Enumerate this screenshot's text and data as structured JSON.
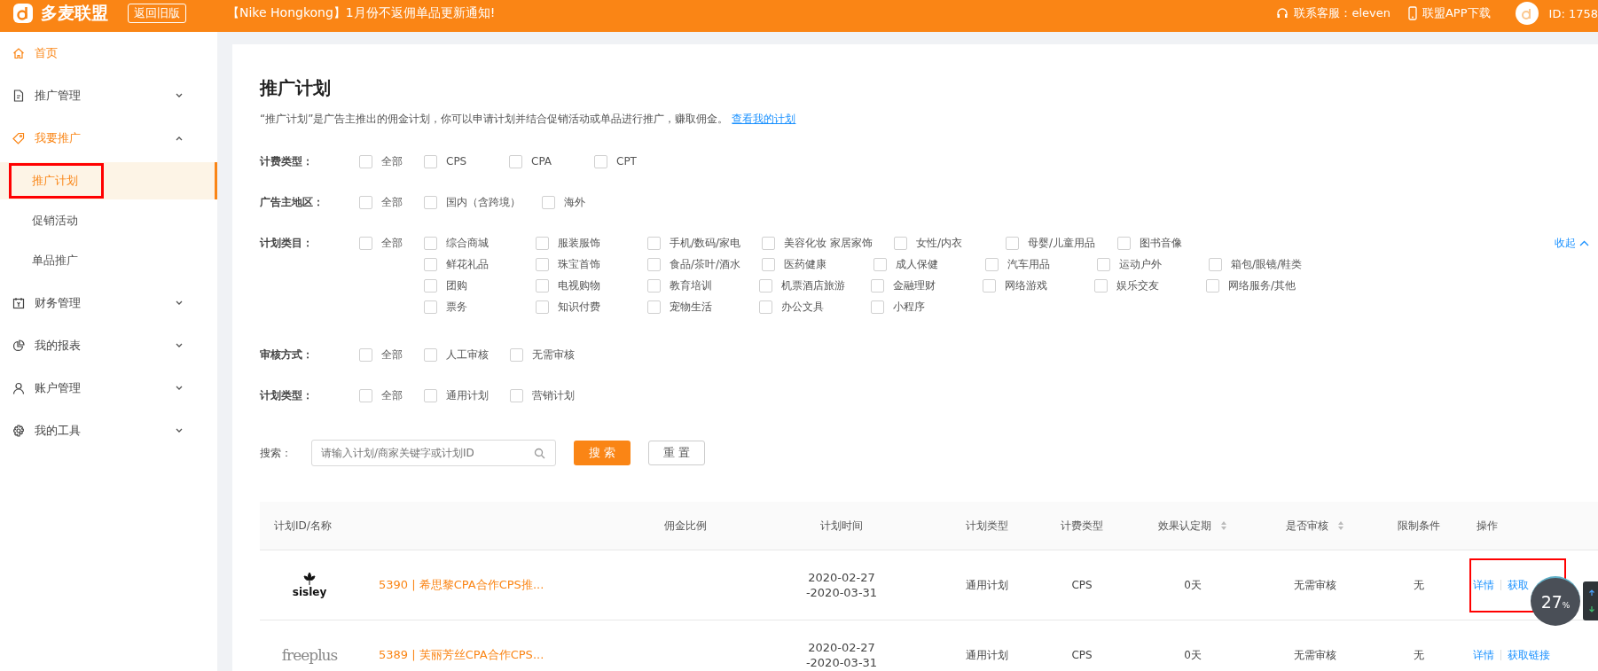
{
  "header": {
    "brand": "多麦联盟",
    "old_version_button": "返回旧版",
    "notice": "【Nike Hongkong】1月份不返佣单品更新通知!",
    "service": "联系客服：eleven",
    "app_download": "联盟APP下载",
    "user_id": "ID: 1758"
  },
  "sidebar": {
    "items": [
      {
        "label": "首页",
        "active": true
      },
      {
        "label": "推广管理",
        "active": false,
        "expanded": false
      },
      {
        "label": "我要推广",
        "active": true,
        "expanded": true,
        "children": [
          {
            "label": "推广计划",
            "selected": true,
            "annotated": true
          },
          {
            "label": "促销活动",
            "selected": false,
            "annotated": false
          },
          {
            "label": "单品推广",
            "selected": false,
            "annotated": false
          }
        ]
      },
      {
        "label": "财务管理",
        "active": false,
        "expanded": false
      },
      {
        "label": "我的报表",
        "active": false,
        "expanded": false
      },
      {
        "label": "账户管理",
        "active": false,
        "expanded": false
      },
      {
        "label": "我的工具",
        "active": false,
        "expanded": false
      }
    ]
  },
  "page": {
    "title": "推广计划",
    "description": "“推广计划”是广告主推出的佣金计划，你可以申请计划并结合促销活动或单品进行推广，赚取佣金。",
    "description_link": "查看我的计划"
  },
  "filters": [
    {
      "label": "计费类型：",
      "all": {
        "label": "全部",
        "checked": false
      },
      "rows": [
        [
          {
            "label": "CPS",
            "checked": false
          },
          {
            "label": "CPA",
            "checked": false
          },
          {
            "label": "CPT",
            "checked": false
          }
        ]
      ]
    },
    {
      "label": "广告主地区：",
      "all": {
        "label": "全部",
        "checked": false
      },
      "rows": [
        [
          {
            "label": "国内（含跨境）",
            "checked": false
          },
          {
            "label": "海外",
            "checked": false
          }
        ]
      ]
    },
    {
      "label": "计划类目：",
      "collapse_link": "收起",
      "all": {
        "label": "全部",
        "checked": false
      },
      "rows": [
        [
          {
            "label": "综合商城",
            "checked": false
          },
          {
            "label": "服装服饰",
            "checked": false
          },
          {
            "label": "手机/数码/家电",
            "checked": false
          },
          {
            "label": "美容化妆 家居家饰",
            "checked": false
          },
          {
            "label": "女性/内衣",
            "checked": false
          },
          {
            "label": "母婴/儿童用品",
            "checked": false
          },
          {
            "label": "图书音像",
            "checked": false
          }
        ],
        [
          {
            "label": "鲜花礼品",
            "checked": false
          },
          {
            "label": "珠宝首饰",
            "checked": false
          },
          {
            "label": "食品/茶叶/酒水",
            "checked": false
          },
          {
            "label": "医药健康",
            "checked": false
          },
          {
            "label": "成人保健",
            "checked": false
          },
          {
            "label": "汽车用品",
            "checked": false
          },
          {
            "label": "运动户外",
            "checked": false
          },
          {
            "label": "箱包/眼镜/鞋类",
            "checked": false
          }
        ],
        [
          {
            "label": "团购",
            "checked": false
          },
          {
            "label": "电视购物",
            "checked": false
          },
          {
            "label": "教育培训",
            "checked": false
          },
          {
            "label": "机票酒店旅游",
            "checked": false
          },
          {
            "label": "金融理财",
            "checked": false
          },
          {
            "label": "网络游戏",
            "checked": false
          },
          {
            "label": "娱乐交友",
            "checked": false
          },
          {
            "label": "网络服务/其他",
            "checked": false
          }
        ],
        [
          {
            "label": "票务",
            "checked": false
          },
          {
            "label": "知识付费",
            "checked": false
          },
          {
            "label": "宠物生活",
            "checked": false
          },
          {
            "label": "办公文具",
            "checked": false
          },
          {
            "label": "小程序",
            "checked": false
          }
        ]
      ]
    },
    {
      "label": "审核方式：",
      "all": {
        "label": "全部",
        "checked": false
      },
      "rows": [
        [
          {
            "label": "人工审核",
            "checked": false
          },
          {
            "label": "无需审核",
            "checked": false
          }
        ]
      ]
    },
    {
      "label": "计划类型：",
      "all": {
        "label": "全部",
        "checked": false
      },
      "rows": [
        [
          {
            "label": "通用计划",
            "checked": false
          },
          {
            "label": "营销计划",
            "checked": false
          }
        ]
      ]
    }
  ],
  "search": {
    "label": "搜索：",
    "placeholder": "请输入计划/商家关键字或计划ID",
    "search_button": "搜 索",
    "reset_button": "重 置"
  },
  "table": {
    "columns": [
      {
        "label": "计划ID/名称",
        "sortable": false
      },
      {
        "label": "佣金比例",
        "sortable": false
      },
      {
        "label": "计划时间",
        "sortable": false
      },
      {
        "label": "计划类型",
        "sortable": false
      },
      {
        "label": "计费类型",
        "sortable": false
      },
      {
        "label": "效果认定期",
        "sortable": true
      },
      {
        "label": "是否审核",
        "sortable": true
      },
      {
        "label": "限制条件",
        "sortable": false
      },
      {
        "label": "操作",
        "sortable": false
      }
    ],
    "rows": [
      {
        "logo_text": "sisley",
        "kind": "flower",
        "name": "5390 | 希思黎CPA合作CPS推...",
        "time_start": "2020-02-27",
        "time_end": "-2020-03-31",
        "plan_type": "通用计划",
        "billing": "CPS",
        "period": "0天",
        "review": "无需审核",
        "limit": "无",
        "actions": [
          "详情",
          "获取"
        ],
        "annotated": true
      },
      {
        "logo_text": "freeplus",
        "kind": "script",
        "name": "5389 | 芙丽芳丝CPA合作CPS...",
        "time_start": "2020-02-27",
        "time_end": "-2020-03-31",
        "plan_type": "通用计划",
        "billing": "CPS",
        "period": "0天",
        "review": "无需审核",
        "limit": "无",
        "actions": [
          "详情",
          "获取链接"
        ],
        "annotated": false
      }
    ]
  },
  "float_widget": {
    "value": "27",
    "unit": "%"
  }
}
